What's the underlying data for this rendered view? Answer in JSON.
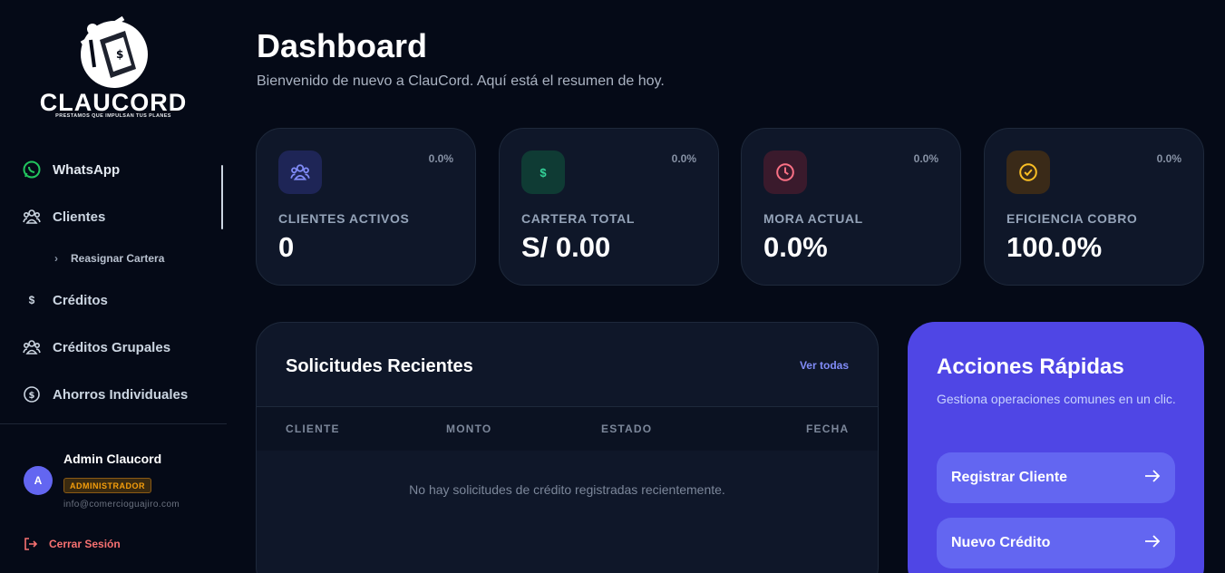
{
  "brand": {
    "name": "CLAUCORD",
    "tagline": "PRESTAMOS QUE IMPULSAN TUS PLANES"
  },
  "sidebar": {
    "items": [
      {
        "label": "WhatsApp",
        "icon": "whatsapp-icon"
      },
      {
        "label": "Clientes",
        "icon": "users-icon"
      },
      {
        "label": "Créditos",
        "icon": "dollar-icon"
      },
      {
        "label": "Créditos Grupales",
        "icon": "users-icon"
      },
      {
        "label": "Ahorros Individuales",
        "icon": "coin-icon"
      }
    ],
    "subitem": {
      "label": "Reasignar Cartera",
      "icon": "chevron-right-icon"
    }
  },
  "user": {
    "initial": "A",
    "name": "Admin Claucord",
    "role": "ADMINISTRADOR",
    "email": "info@comercioguajiro.com"
  },
  "logout": {
    "label": "Cerrar Sesión"
  },
  "header": {
    "title": "Dashboard",
    "subtitle": "Bienvenido de nuevo a ClauCord. Aquí está el resumen de hoy."
  },
  "stats": [
    {
      "label": "CLIENTES ACTIVOS",
      "value": "0",
      "change": "0.0%",
      "icon": "users-icon",
      "color": "#818cf8",
      "bg": "#1e2556"
    },
    {
      "label": "CARTERA TOTAL",
      "value": "S/ 0.00",
      "change": "0.0%",
      "icon": "dollar-icon",
      "color": "#34d399",
      "bg": "#0f3b34"
    },
    {
      "label": "MORA ACTUAL",
      "value": "0.0%",
      "change": "0.0%",
      "icon": "clock-icon",
      "color": "#fb7185",
      "bg": "#3a1a2c"
    },
    {
      "label": "EFICIENCIA COBRO",
      "value": "100.0%",
      "change": "0.0%",
      "icon": "check-circle-icon",
      "color": "#fbbf24",
      "bg": "#3a2a18"
    }
  ],
  "recent": {
    "title": "Solicitudes Recientes",
    "link": "Ver todas",
    "columns": [
      "CLIENTE",
      "MONTO",
      "ESTADO",
      "FECHA"
    ],
    "empty_message": "No hay solicitudes de crédito registradas recientemente."
  },
  "quick_actions": {
    "title": "Acciones Rápidas",
    "subtitle": "Gestiona operaciones comunes en un clic.",
    "buttons": [
      {
        "label": "Registrar Cliente",
        "icon": "arrow-right-icon"
      },
      {
        "label": "Nuevo Crédito",
        "icon": "arrow-right-icon"
      }
    ]
  }
}
